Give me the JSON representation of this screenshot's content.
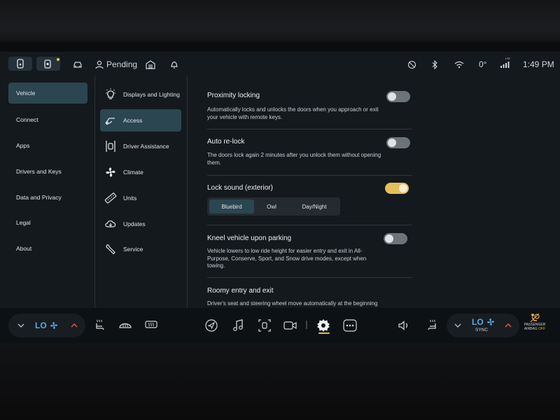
{
  "status_bar": {
    "pending_label": "Pending",
    "temperature": "0°",
    "clock": "1:49 PM",
    "signal_tech": "LTE"
  },
  "nav": {
    "items": [
      {
        "label": "Vehicle"
      },
      {
        "label": "Connect"
      },
      {
        "label": "Apps"
      },
      {
        "label": "Drivers and Keys"
      },
      {
        "label": "Data and Privacy"
      },
      {
        "label": "Legal"
      },
      {
        "label": "About"
      }
    ]
  },
  "subnav": {
    "items": [
      {
        "label": "Displays and Lighting",
        "icon": "lightbulb-icon"
      },
      {
        "label": "Access",
        "icon": "car-door-icon"
      },
      {
        "label": "Driver Assistance",
        "icon": "lane-assist-icon"
      },
      {
        "label": "Climate",
        "icon": "fan-icon"
      },
      {
        "label": "Units",
        "icon": "ruler-icon"
      },
      {
        "label": "Updates",
        "icon": "cloud-download-icon"
      },
      {
        "label": "Service",
        "icon": "wrench-icon"
      }
    ]
  },
  "settings": {
    "proximity": {
      "title": "Proximity locking",
      "desc": "Automatically locks and unlocks the doors when you approach or exit your vehicle with remote keys.",
      "enabled": false
    },
    "relock": {
      "title": "Auto re-lock",
      "desc": "The doors lock again 2 minutes after you unlock them without opening them.",
      "enabled": false
    },
    "lock_sound": {
      "title": "Lock sound (exterior)",
      "enabled": true,
      "options": [
        "Bluebird",
        "Owl",
        "Day/Night"
      ],
      "selected": "Bluebird"
    },
    "kneel": {
      "title": "Kneel vehicle upon parking",
      "desc": "Vehicle lowers to low ride height for easier entry and exit in All-Purpose, Conserve, Sport, and Snow drive modes, except when towing.",
      "enabled": false
    },
    "roomy": {
      "title": "Roomy entry and exit",
      "desc": "Driver's seat and steering wheel move automatically at the beginning and end of a drive for easier access."
    }
  },
  "dock": {
    "left_temp": "LO",
    "right_temp": "LO",
    "sync_label": "SYNC",
    "airbag_line1": "PASSENGER",
    "airbag_line2": "AIRBAG",
    "airbag_state": "OFF"
  },
  "colors": {
    "accent": "#e6be5a",
    "selected_bg": "#2b4651",
    "temp_blue": "#5aa9e6"
  }
}
